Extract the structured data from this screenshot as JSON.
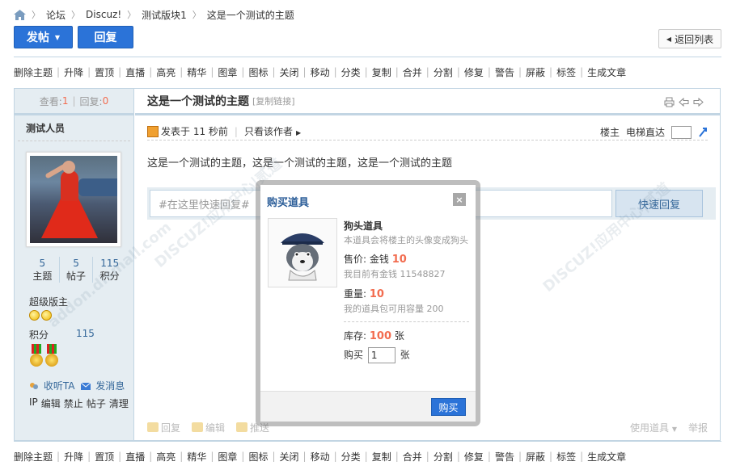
{
  "breadcrumb": {
    "items": [
      "论坛",
      "Discuz!",
      "测试版块1",
      "这是一个测试的主题"
    ]
  },
  "actions": {
    "post_label": "发帖",
    "reply_label": "回复",
    "back_label": "返回列表"
  },
  "mod_tools": [
    "删除主题",
    "升降",
    "置顶",
    "直播",
    "高亮",
    "精华",
    "图章",
    "图标",
    "关闭",
    "移动",
    "分类",
    "复制",
    "合并",
    "分割",
    "修复",
    "警告",
    "屏蔽",
    "标签",
    "生成文章"
  ],
  "thread": {
    "views_label": "查看:",
    "views": "1",
    "replies_label": "回复:",
    "replies": "0",
    "title": "这是一个测试的主题",
    "copy_link": "[复制链接]"
  },
  "author": {
    "name": "测试人员",
    "stats": [
      {
        "num": "5",
        "label": "主题"
      },
      {
        "num": "5",
        "label": "帖子"
      },
      {
        "num": "115",
        "label": "积分"
      }
    ],
    "group": "超级版主",
    "credit_label": "积分",
    "credit_value": "115",
    "follow_label": "收听TA",
    "message_label": "发消息",
    "admin_links": [
      "IP",
      "编辑",
      "禁止",
      "帖子",
      "清理"
    ]
  },
  "post": {
    "posted_at": "发表于 11 秒前",
    "author_only": "只看该作者",
    "floor_label": "楼主",
    "jump_label": "电梯直达",
    "body": "这是一个测试的主题，这是一个测试的主题，这是一个测试的主题",
    "quick_reply_placeholder": "#在这里快速回复#",
    "quick_reply_button": "快速回复",
    "foot_actions": [
      "回复",
      "编辑",
      "推送"
    ],
    "use_item": "使用道具",
    "report": "举报"
  },
  "watermarks": [
    "DISCUZ!应用中心|贰道",
    "addon.dismall.com"
  ],
  "modal": {
    "title": "购买道具",
    "close": "×",
    "item_name": "狗头道具",
    "item_desc": "本道具会将楼主的头像变成狗头",
    "price_label": "售价: 金钱",
    "price": "10",
    "balance_text": "我目前有金钱 11548827",
    "weight_label": "重量:",
    "weight": "10",
    "capacity_text": "我的道具包可用容量 200",
    "stock_label": "库存:",
    "stock": "100",
    "stock_unit": "张",
    "buy_label": "购买",
    "qty_value": "1",
    "qty_unit": "张",
    "buy_button": "购买"
  },
  "colors": {
    "accent_blue": "#2b73d8",
    "border": "#c2d5e3",
    "side_bg": "#e5edf2",
    "highlight_red": "#f26c4f"
  }
}
